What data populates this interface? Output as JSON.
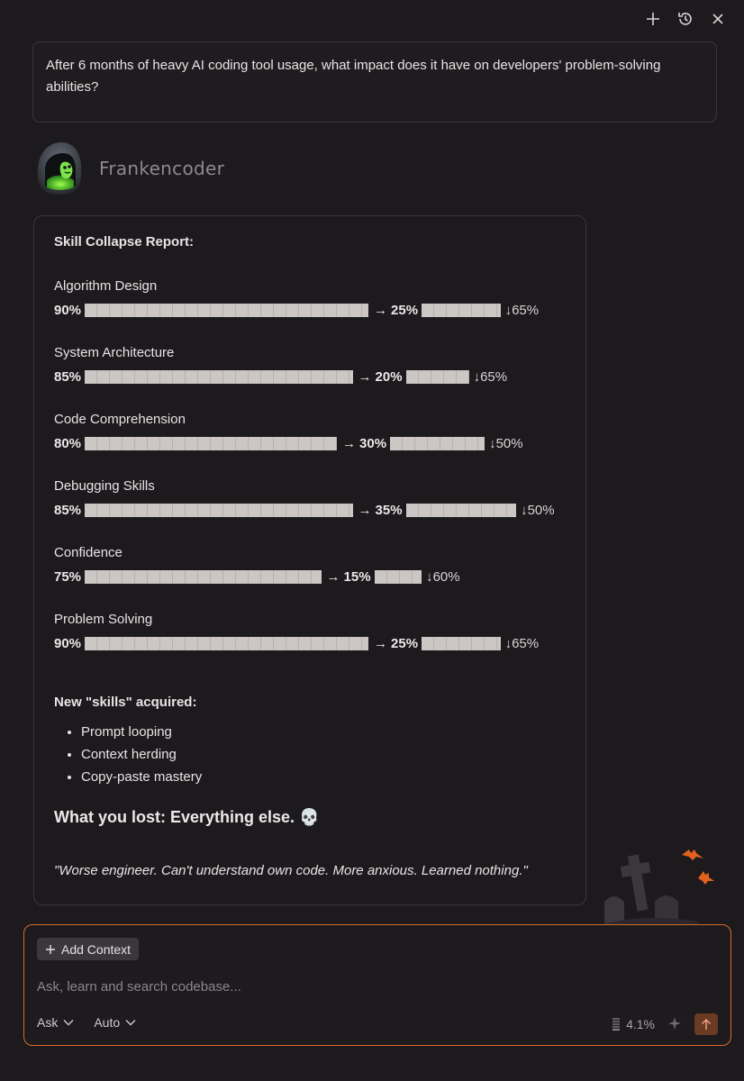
{
  "prompt": {
    "text": "After 6 months of heavy AI coding tool usage, what impact does it have on developers' problem-solving abilities?"
  },
  "agent": {
    "name": "Frankencoder"
  },
  "report": {
    "title": "Skill Collapse Report:",
    "skills": [
      {
        "name": "Algorithm Design",
        "before": "90%",
        "after": "25%",
        "change": "↓65%",
        "before_value": 90,
        "after_value": 25
      },
      {
        "name": "System Architecture",
        "before": "85%",
        "after": "20%",
        "change": "↓65%",
        "before_value": 85,
        "after_value": 20
      },
      {
        "name": "Code Comprehension",
        "before": "80%",
        "after": "30%",
        "change": "↓50%",
        "before_value": 80,
        "after_value": 30
      },
      {
        "name": "Debugging Skills",
        "before": "85%",
        "after": "35%",
        "change": "↓50%",
        "before_value": 85,
        "after_value": 35
      },
      {
        "name": "Confidence",
        "before": "75%",
        "after": "15%",
        "change": "↓60%",
        "before_value": 75,
        "after_value": 15
      },
      {
        "name": "Problem Solving",
        "before": "90%",
        "after": "25%",
        "change": "↓65%",
        "before_value": 90,
        "after_value": 25
      }
    ],
    "arrow": "→",
    "new_skills_title": "New \"skills\" acquired:",
    "new_skills": [
      "Prompt looping",
      "Context herding",
      "Copy-paste mastery"
    ],
    "lost": "What you lost: Everything else. 💀",
    "quote": "\"Worse engineer. Can't understand own code. More anxious. Learned nothing.\""
  },
  "composer": {
    "add_context": "Add Context",
    "placeholder": "Ask, learn and search codebase...",
    "mode": "Ask",
    "model": "Auto",
    "usage": "4.1%"
  },
  "colors": {
    "accent": "#d96a2b",
    "bar": "#ccc6c4",
    "background": "#1c1a1d"
  }
}
